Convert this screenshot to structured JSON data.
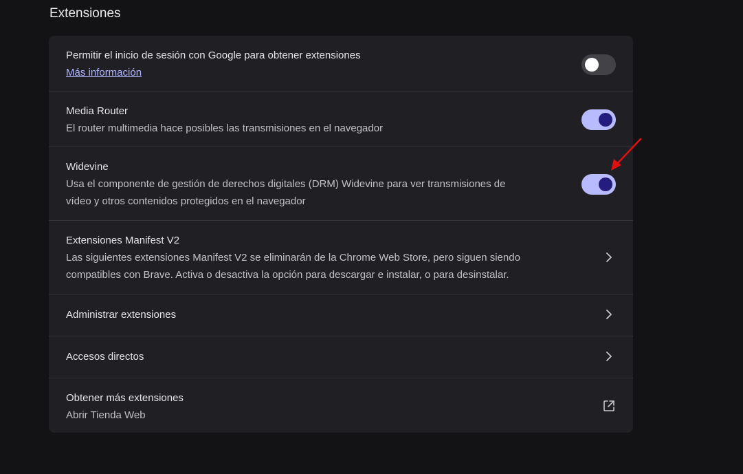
{
  "section": {
    "title": "Extensiones"
  },
  "rows": [
    {
      "title": "Permitir el inicio de sesión con Google para obtener extensiones",
      "link": "Más información",
      "control": "toggle",
      "state": "off"
    },
    {
      "title": "Media Router",
      "subtitle": "El router multimedia hace posibles las transmisiones en el navegador",
      "control": "toggle",
      "state": "on"
    },
    {
      "title": "Widevine",
      "subtitle_line1": "Usa el componente de gestión de derechos digitales (DRM) Widevine para ver transmisiones de",
      "subtitle_line2": "vídeo y otros contenidos protegidos en el navegador",
      "control": "toggle",
      "state": "on"
    },
    {
      "title": "Extensiones Manifest V2",
      "subtitle_line1": "Las siguientes extensiones Manifest V2 se eliminarán de la Chrome Web Store, pero siguen siendo",
      "subtitle_line2": "compatibles con Brave. Activa o desactiva la opción para descargar e instalar, o para desinstalar.",
      "control": "chevron-right-icon"
    },
    {
      "title": "Administrar extensiones",
      "control": "chevron-right-icon"
    },
    {
      "title": "Accesos directos",
      "control": "chevron-right-icon"
    },
    {
      "title": "Obtener más extensiones",
      "subtitle": "Abrir Tienda Web",
      "control": "external-link-icon"
    }
  ],
  "colors": {
    "background": "#131316",
    "card": "#202024",
    "toggle_on_track": "#b9bbff",
    "toggle_on_knob": "#241c7e",
    "toggle_off_track": "#434347",
    "link": "#aeb4ff",
    "annotation_arrow": "#e01010"
  }
}
